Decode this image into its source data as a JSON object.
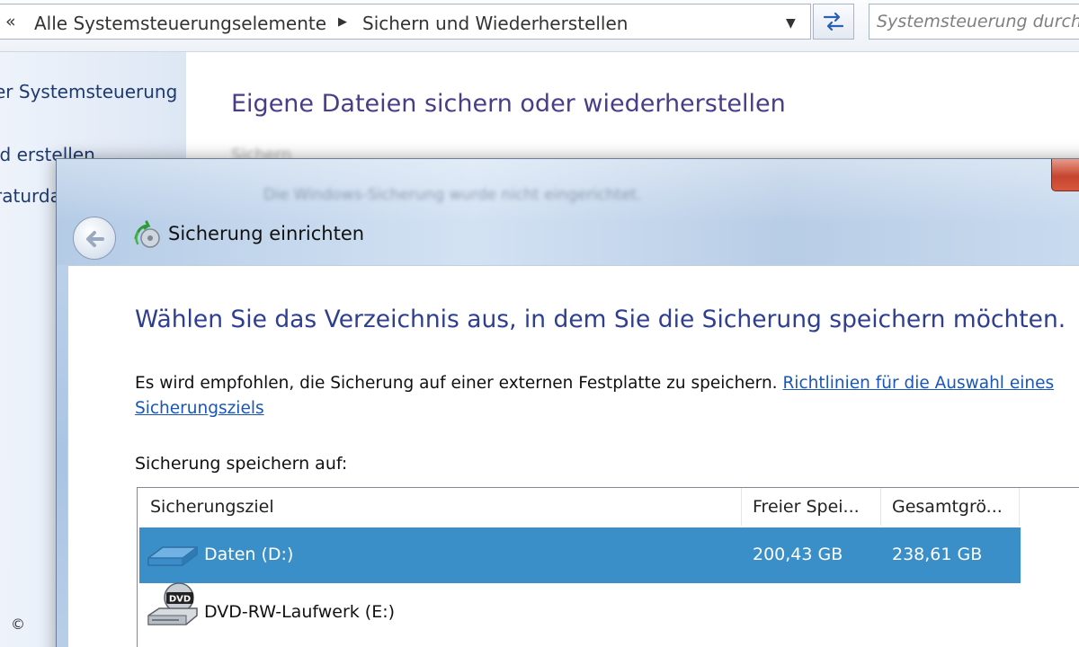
{
  "address_bar": {
    "chevron": "«",
    "crumbs": [
      "Alle Systemsteuerungselemente",
      "Sichern und Wiederherstellen"
    ],
    "separator": "▶",
    "dropdown": "▼",
    "search_placeholder": "Systemsteuerung durchsuchen"
  },
  "left_pane": {
    "items": [
      "er Systemsteuerung",
      "ld erstellen",
      "raturda"
    ]
  },
  "copyright": "©",
  "background": {
    "title": "Eigene Dateien sichern oder wiederherstellen",
    "faint_label": "Sichern",
    "blurred_text": "Die Windows-Sicherung wurde nicht eingerichtet."
  },
  "dialog": {
    "title": "Sicherung einrichten",
    "heading": "Wählen Sie das Verzeichnis aus, in dem Sie die Sicherung speichern möchten.",
    "recommend_text": "Es wird empfohlen, die Sicherung auf einer externen Festplatte zu speichern.",
    "recommend_link": "Richtlinien für die Auswahl eines Sicherungsziels",
    "save_label": "Sicherung speichern auf:",
    "columns": [
      "Sicherungsziel",
      "Freier Spei...",
      "Gesamtgrö..."
    ],
    "rows": [
      {
        "name": "Daten (D:)",
        "free": "200,43 GB",
        "total": "238,61 GB",
        "icon": "hard-drive-icon",
        "selected": true
      },
      {
        "name": "DVD-RW-Laufwerk (E:)",
        "free": "",
        "total": "",
        "icon": "dvd-drive-icon",
        "dvd_label": "DVD",
        "selected": false
      }
    ]
  },
  "colors": {
    "heading": "#2f3f8f",
    "link": "#1a56b5",
    "selection": "#3a8fc8",
    "close_button": "#c64530"
  }
}
